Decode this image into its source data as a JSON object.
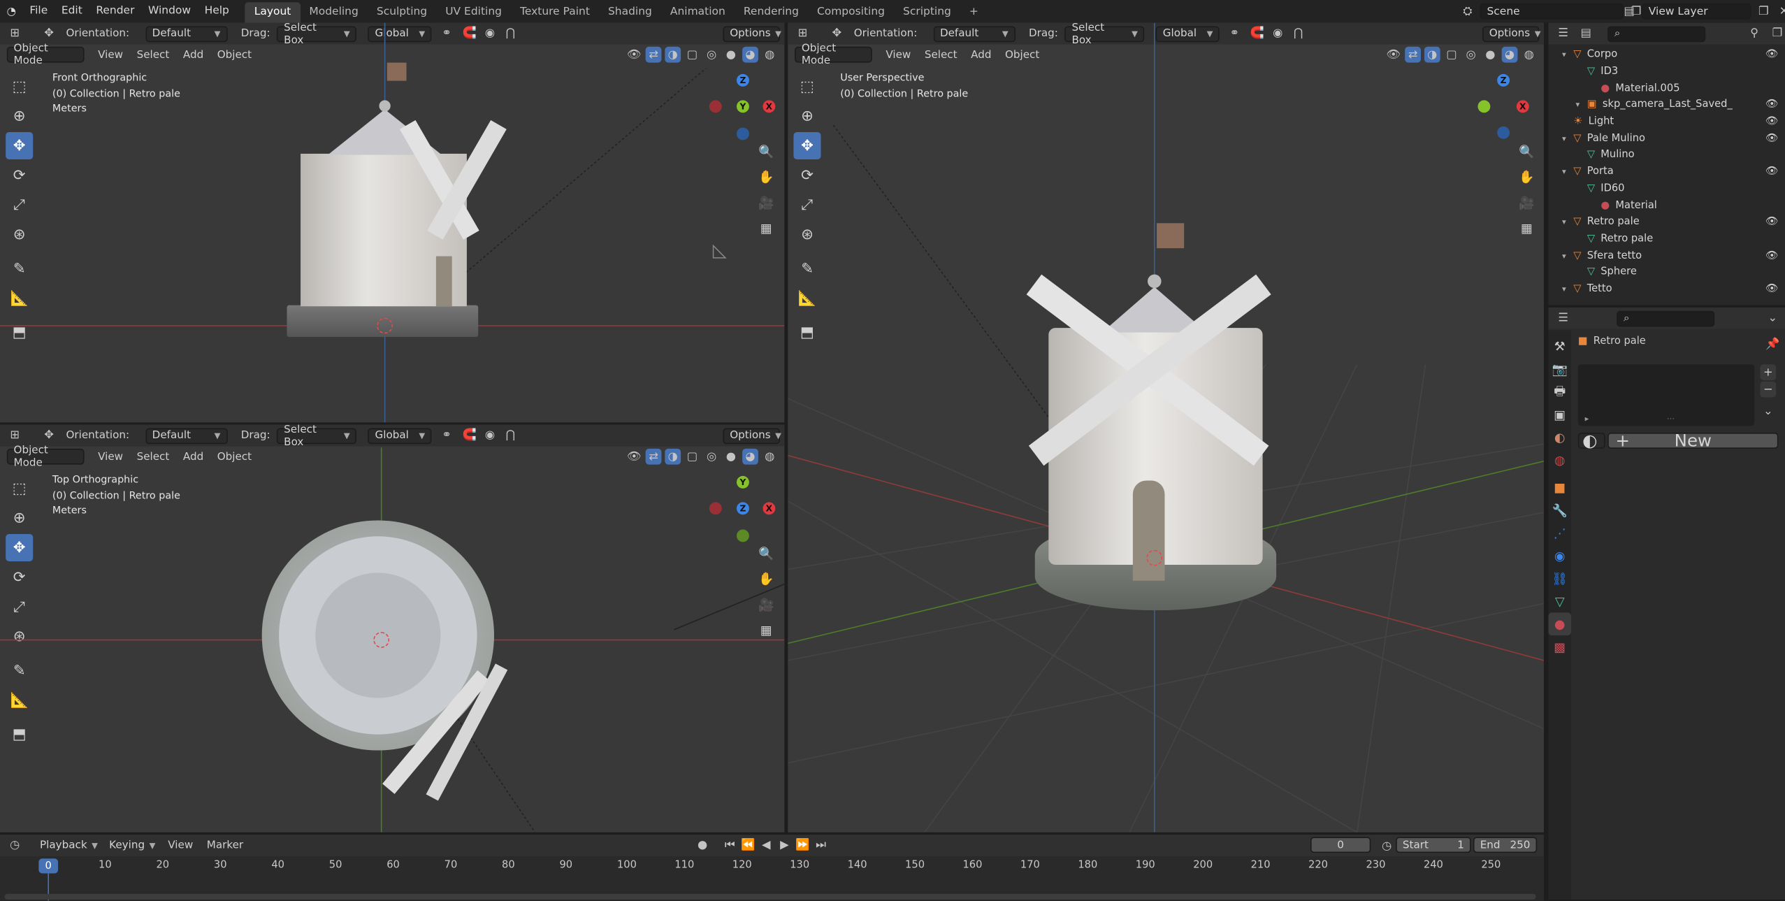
{
  "topbar": {
    "menus": [
      "File",
      "Edit",
      "Render",
      "Window",
      "Help"
    ],
    "workspaces": [
      "Layout",
      "Modeling",
      "Sculpting",
      "UV Editing",
      "Texture Paint",
      "Shading",
      "Animation",
      "Rendering",
      "Compositing",
      "Scripting"
    ],
    "active_workspace": "Layout",
    "add_workspace": "+",
    "scene": "Scene",
    "view_layer": "View Layer"
  },
  "viewport_header": {
    "orientation_label": "Orientation:",
    "orientation_value": "Default",
    "drag_label": "Drag:",
    "drag_value": "Select Box",
    "transform_value": "Global",
    "options": "Options",
    "mode": "Object Mode",
    "menu_view": "View",
    "menu_select": "Select",
    "menu_add": "Add",
    "menu_object": "Object"
  },
  "viewports": {
    "front": {
      "title": "Front Orthographic",
      "collection": "(0) Collection | Retro pale",
      "units": "Meters"
    },
    "top": {
      "title": "Top Orthographic",
      "collection": "(0) Collection | Retro pale",
      "units": "Meters"
    },
    "persp": {
      "title": "User Perspective",
      "collection": "(0) Collection | Retro pale"
    }
  },
  "gizmo_labels": {
    "x": "X",
    "y": "Y",
    "z": "Z"
  },
  "outliner": {
    "search_placeholder": "",
    "items": [
      {
        "indent": 1,
        "label": "Corpo",
        "type": "object",
        "eye": true
      },
      {
        "indent": 2,
        "label": "ID3",
        "type": "mesh",
        "eye": false
      },
      {
        "indent": 3,
        "label": "Material.005",
        "type": "material",
        "eye": false
      },
      {
        "indent": 2,
        "label": "skp_camera_Last_Saved_",
        "type": "camera",
        "eye": true
      },
      {
        "indent": 1,
        "label": "Light",
        "type": "light",
        "eye": true
      },
      {
        "indent": 1,
        "label": "Pale Mulino",
        "type": "object",
        "eye": true
      },
      {
        "indent": 2,
        "label": "Mulino",
        "type": "mesh",
        "eye": false
      },
      {
        "indent": 1,
        "label": "Porta",
        "type": "object",
        "eye": true
      },
      {
        "indent": 2,
        "label": "ID60",
        "type": "mesh",
        "eye": false
      },
      {
        "indent": 3,
        "label": "Material",
        "type": "material",
        "eye": false
      },
      {
        "indent": 1,
        "label": "Retro pale",
        "type": "object",
        "eye": true
      },
      {
        "indent": 2,
        "label": "Retro pale",
        "type": "mesh",
        "eye": false
      },
      {
        "indent": 1,
        "label": "Sfera tetto",
        "type": "object",
        "eye": true
      },
      {
        "indent": 2,
        "label": "Sphere",
        "type": "mesh",
        "eye": false
      },
      {
        "indent": 1,
        "label": "Tetto",
        "type": "object",
        "eye": true
      }
    ]
  },
  "properties": {
    "object_name": "Retro pale",
    "new_button": "New",
    "add": "+",
    "remove": "−"
  },
  "timeline": {
    "menus": [
      "Playback",
      "Keying",
      "View",
      "Marker"
    ],
    "current_frame": "0",
    "start_label": "Start",
    "start_value": "1",
    "end_label": "End",
    "end_value": "250",
    "ticks": [
      "0",
      "10",
      "20",
      "30",
      "40",
      "50",
      "60",
      "70",
      "80",
      "90",
      "100",
      "110",
      "120",
      "130",
      "140",
      "150",
      "160",
      "170",
      "180",
      "190",
      "200",
      "210",
      "220",
      "230",
      "240",
      "250"
    ],
    "playhead": "0"
  },
  "colors": {
    "accent": "#4772b3",
    "x_axis": "#e0393f",
    "y_axis": "#86c22a",
    "z_axis": "#3b86e8",
    "object_orange": "#e8863a",
    "mesh_green": "#4fc29a",
    "material_red": "#c84c55"
  }
}
